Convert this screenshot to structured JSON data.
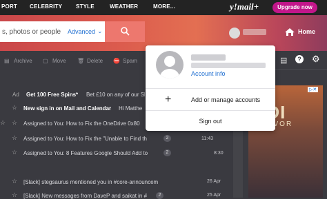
{
  "nav": {
    "links": [
      "PORT",
      "CELEBRITY",
      "STYLE",
      "WEATHER",
      "MORE..."
    ],
    "logo": "y!mail+",
    "upgrade": "Upgrade now"
  },
  "search": {
    "placeholder": "s, photos or people",
    "advanced": "Advanced"
  },
  "header": {
    "home": "Home"
  },
  "toolbar": {
    "archive": "Archive",
    "move": "Move",
    "delete": "Delete",
    "spam": "Spam"
  },
  "messages": [
    {
      "prefix": "Ad",
      "sender": "Get 100 Free Spins*",
      "preview": "Bet £10 on any of our Sl",
      "badge": "",
      "date": ""
    },
    {
      "prefix": "",
      "sender": "",
      "preview": "New sign in on Mail and Calendar",
      "preview2": "Hi Matthe",
      "badge": "",
      "date": ""
    },
    {
      "prefix": "",
      "sender": "",
      "preview": "Assigned to You: How to Fix the OneDrive 0x80",
      "badge": "",
      "date": ""
    },
    {
      "prefix": "",
      "sender": "",
      "preview": "Assigned to You: How to Fix the \"Unable to Find th",
      "badge": "2",
      "date": "11:43"
    },
    {
      "prefix": "",
      "sender": "",
      "preview": "Assigned to You: 8 Features Google Should Add to",
      "badge": "2",
      "date": "8:30"
    },
    {
      "prefix": "",
      "sender": "",
      "preview": "[Slack] stegsaurus mentioned you in #core-announcem",
      "badge": "",
      "date": "26 Apr"
    },
    {
      "prefix": "",
      "sender": "",
      "preview": "[Slack] New messages from DaveP and saikat in #",
      "badge": "2",
      "date": "25 Apr"
    }
  ],
  "ad": {
    "title": "EDI",
    "subtitle": "RVIVOR"
  },
  "dropdown": {
    "account_info": "Account info",
    "add_manage": "Add or manage accounts",
    "sign_out": "Sign out"
  }
}
